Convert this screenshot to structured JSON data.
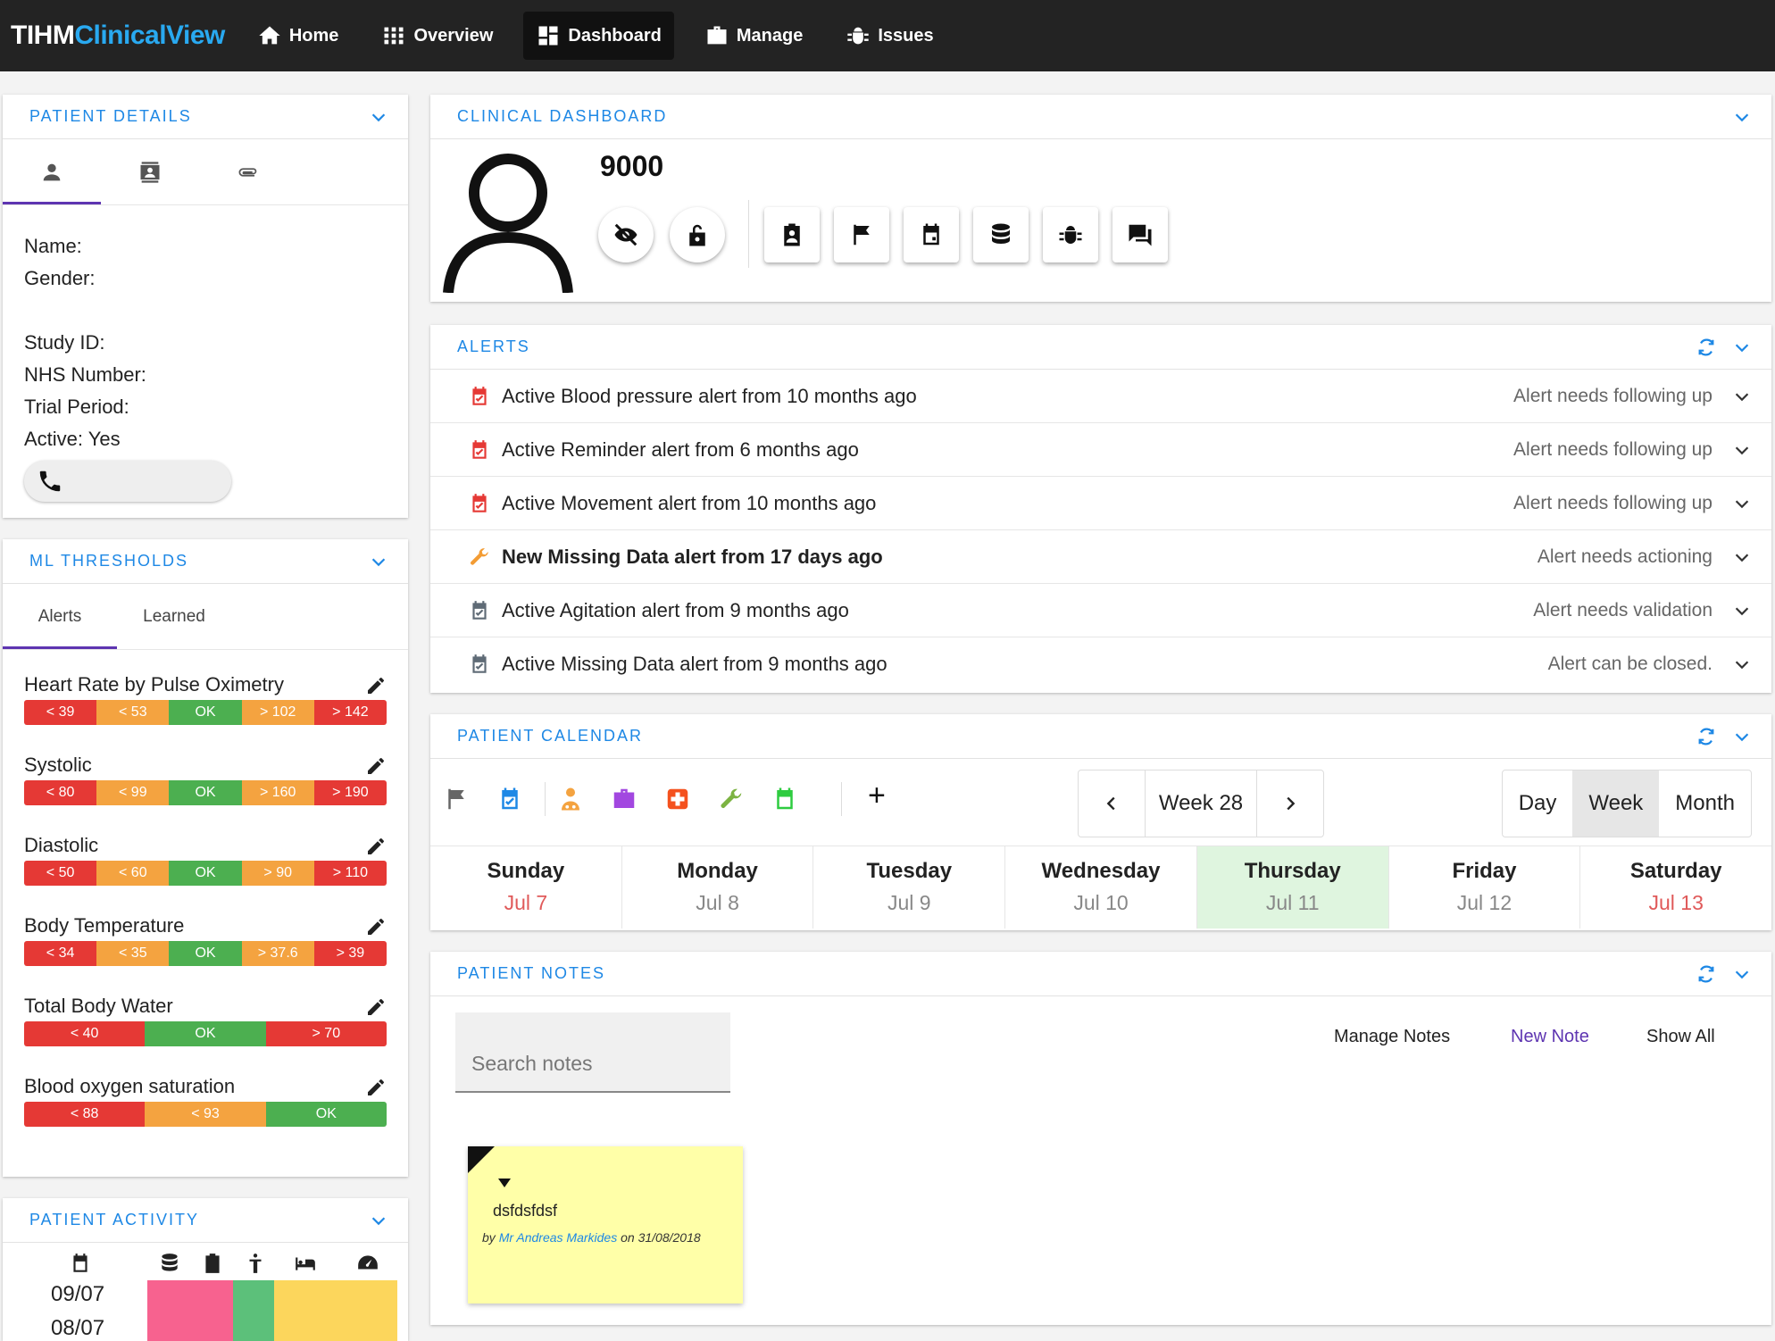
{
  "app": {
    "brand_part1": "TIHM",
    "brand_part2": "ClinicalView"
  },
  "nav": {
    "home": "Home",
    "overview": "Overview",
    "dashboard": "Dashboard",
    "manage": "Manage",
    "issues": "Issues",
    "active": "Dashboard"
  },
  "patient_details": {
    "title": "PATIENT DETAILS",
    "tabs": [
      "person-icon",
      "contact-card-icon",
      "paperclip-icon"
    ],
    "name_label": "Name:",
    "gender_label": "Gender:",
    "study_id_label": "Study ID:",
    "nhs_label": "NHS Number:",
    "trial_label": "Trial Period:",
    "active_label": "Active:",
    "active_value": "Yes"
  },
  "ml_thresholds": {
    "title": "ML THRESHOLDS",
    "tabs": [
      "Alerts",
      "Learned"
    ],
    "items": [
      {
        "label": "Heart Rate by Pulse Oximetry",
        "segments": [
          "< 39",
          "< 53",
          "OK",
          "> 102",
          "> 142"
        ]
      },
      {
        "label": "Systolic",
        "segments": [
          "< 80",
          "< 99",
          "OK",
          "> 160",
          "> 190"
        ]
      },
      {
        "label": "Diastolic",
        "segments": [
          "< 50",
          "< 60",
          "OK",
          "> 90",
          "> 110"
        ]
      },
      {
        "label": "Body Temperature",
        "segments": [
          "< 34",
          "< 35",
          "OK",
          "> 37.6",
          "> 39"
        ]
      },
      {
        "label": "Total Body Water",
        "segments": [
          "< 40",
          "OK",
          "> 70"
        ]
      },
      {
        "label": "Blood oxygen saturation",
        "segments": [
          "< 88",
          "< 93",
          "OK"
        ]
      }
    ]
  },
  "patient_activity": {
    "title": "PATIENT ACTIVITY",
    "rows": [
      "09/07",
      "08/07"
    ]
  },
  "clinical_dashboard": {
    "title": "CLINICAL DASHBOARD",
    "patient_id": "9000"
  },
  "alerts": {
    "title": "ALERTS",
    "items": [
      {
        "text": "Active Blood pressure alert from 10 months ago",
        "status": "Alert needs following up",
        "icon": "calendar-check-red-icon"
      },
      {
        "text": "Active Reminder alert from 6 months ago",
        "status": "Alert needs following up",
        "icon": "calendar-check-red-icon"
      },
      {
        "text": "Active Movement alert from 10 months ago",
        "status": "Alert needs following up",
        "icon": "calendar-check-red-icon"
      },
      {
        "text": "New Missing Data alert from 17 days ago",
        "status": "Alert needs actioning",
        "icon": "wrench-orange-icon"
      },
      {
        "text": "Active Agitation alert from 9 months ago",
        "status": "Alert needs validation",
        "icon": "calendar-check-grey-icon"
      },
      {
        "text": "Active Missing Data alert from 9 months ago",
        "status": "Alert can be closed.",
        "icon": "calendar-check-grey-icon"
      }
    ]
  },
  "calendar": {
    "title": "PATIENT CALENDAR",
    "week_label": "Week 28",
    "views": [
      "Day",
      "Week",
      "Month"
    ],
    "selected_view": "Week",
    "add_symbol": "+",
    "days": [
      {
        "name": "Sunday",
        "date": "Jul 7"
      },
      {
        "name": "Monday",
        "date": "Jul 8"
      },
      {
        "name": "Tuesday",
        "date": "Jul 9"
      },
      {
        "name": "Wednesday",
        "date": "Jul 10"
      },
      {
        "name": "Thursday",
        "date": "Jul 11"
      },
      {
        "name": "Friday",
        "date": "Jul 12"
      },
      {
        "name": "Saturday",
        "date": "Jul 13"
      }
    ]
  },
  "notes": {
    "title": "PATIENT NOTES",
    "search_placeholder": "Search notes",
    "manage": "Manage Notes",
    "new": "New Note",
    "show_all": "Show All",
    "note": {
      "text": "dsfdsfdsf",
      "by": "by",
      "author": "Mr Andreas Markides",
      "on": "on 31/08/2018"
    }
  },
  "colors": {
    "accent": "#1e88e5",
    "brand_blue": "#29a9f0",
    "threshold_red": "#e53935",
    "threshold_orange": "#f4a340",
    "threshold_green": "#4caf50",
    "today_highlight": "#dff5df",
    "new_note_link": "#5e35b1"
  }
}
